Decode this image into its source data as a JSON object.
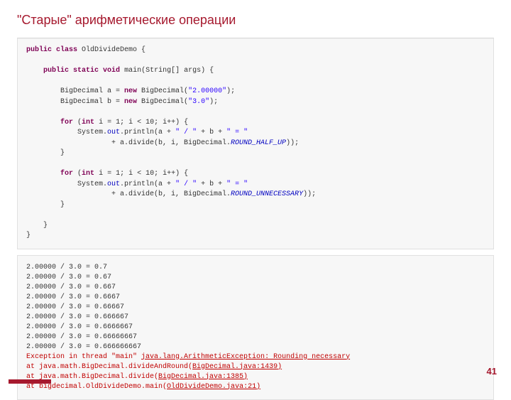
{
  "title": "\"Старые\" арифметические операции",
  "page_number": "41",
  "code": {
    "l1a": "public",
    "l1b": " class",
    "l1c": " OldDivideDemo {",
    "l2a": "public",
    "l2b": " static",
    "l2c": " void",
    "l2d": " main(String[] args) {",
    "l3a": "BigDecimal a = ",
    "l3b": "new",
    "l3c": " BigDecimal(",
    "l3d": "\"2.00000\"",
    "l3e": ");",
    "l4a": "BigDecimal b = ",
    "l4b": "new",
    "l4c": " BigDecimal(",
    "l4d": "\"3.0\"",
    "l4e": ");",
    "l5a": "for",
    "l5b": " (",
    "l5c": "int",
    "l5d": " i = 1; i < 10; i++) {",
    "l6a": "System.",
    "l6b": "out",
    "l6c": ".println(a + ",
    "l6d": "\" / \"",
    "l6e": " + b + ",
    "l6f": "\" = \"",
    "l7a": "                    + a.divide(b, i, BigDecimal.",
    "l7b": "ROUND_HALF_UP",
    "l7c": "));",
    "l8": "}",
    "l9a": "for",
    "l9b": " (",
    "l9c": "int",
    "l9d": " i = 1; i < 10; i++) {",
    "l10a": "System.",
    "l10b": "out",
    "l10c": ".println(a + ",
    "l10d": "\" / \"",
    "l10e": " + b + ",
    "l10f": "\" = \"",
    "l11a": "                    + a.divide(b, i, BigDecimal.",
    "l11b": "ROUND_UNNECESSARY",
    "l11c": "));",
    "l12": "}",
    "l13": "}",
    "l14": "}"
  },
  "output": {
    "r1": "2.00000 / 3.0 = 0.7",
    "r2": "2.00000 / 3.0 = 0.67",
    "r3": "2.00000 / 3.0 = 0.667",
    "r4": "2.00000 / 3.0 = 0.6667",
    "r5": "2.00000 / 3.0 = 0.66667",
    "r6": "2.00000 / 3.0 = 0.666667",
    "r7": "2.00000 / 3.0 = 0.6666667",
    "r8": "2.00000 / 3.0 = 0.66666667",
    "r9": "2.00000 / 3.0 = 0.666666667",
    "e1a": "Exception in thread \"main\" ",
    "e1b": "java.lang.ArithmeticException",
    "e1c": ": Rounding necessary",
    "e2a": "at java.math.BigDecimal.divideAndRound(",
    "e2b": "BigDecimal.java:1439)",
    "e3a": "at java.math.BigDecimal.divide(",
    "e3b": "BigDecimal.java:1385)",
    "e4a": "at bigdecimal.OldDivideDemo.main(",
    "e4b": "OldDivideDemo.java:21)"
  }
}
